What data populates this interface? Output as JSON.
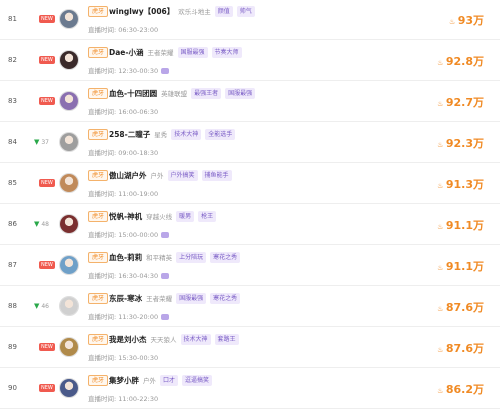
{
  "rows": [
    {
      "rank": "81",
      "new": "NEW",
      "change": "",
      "name": "winglwy【006】",
      "category": "欢乐斗地主",
      "tags": [
        "颜值",
        "帅气"
      ],
      "time_label": "直播时间:",
      "time": "06:30-23:00",
      "chat": false,
      "score": "93万",
      "avatar": "#6b7a8f"
    },
    {
      "rank": "82",
      "new": "NEW",
      "change": "",
      "name": "Dae-小涵",
      "category": "王者荣耀",
      "tags": [
        "国服最强",
        "节奏大师"
      ],
      "time_label": "直播时间:",
      "time": "12:30-00:30",
      "chat": true,
      "score": "92.8万",
      "avatar": "#3a2a2a"
    },
    {
      "rank": "83",
      "new": "NEW",
      "change": "",
      "name": "血色-十四团圆",
      "category": "英雄联盟",
      "tags": [
        "最强王者",
        "国服最强"
      ],
      "time_label": "直播时间:",
      "time": "16:00-06:30",
      "chat": false,
      "score": "92.7万",
      "avatar": "#8a6fb0"
    },
    {
      "rank": "84",
      "new": "",
      "change": "37",
      "name": "258-二瞳子",
      "category": "星秀",
      "tags": [
        "技术大神",
        "全能选手"
      ],
      "time_label": "直播时间:",
      "time": "09:00-18:30",
      "chat": false,
      "score": "92.3万",
      "avatar": "#9e9e9e"
    },
    {
      "rank": "85",
      "new": "NEW",
      "change": "",
      "name": "傲山湖户外",
      "category": "户外",
      "tags": [
        "户外搞笑",
        "捕鱼能手"
      ],
      "time_label": "直播时间:",
      "time": "11:00-19:00",
      "chat": false,
      "score": "91.3万",
      "avatar": "#c08a5a"
    },
    {
      "rank": "86",
      "new": "",
      "change": "48",
      "name": "悦帆-神机",
      "category": "穿越火线",
      "tags": [
        "暖男",
        "枪王"
      ],
      "time_label": "直播时间:",
      "time": "15:00-00:00",
      "chat": true,
      "score": "91.1万",
      "avatar": "#7a2f2f"
    },
    {
      "rank": "87",
      "new": "NEW",
      "change": "",
      "name": "血色-莉莉",
      "category": "和平精英",
      "tags": [
        "上分陪玩",
        "寒花之秀"
      ],
      "time_label": "直播时间:",
      "time": "16:30-04:30",
      "chat": true,
      "score": "91.1万",
      "avatar": "#6fa0c8"
    },
    {
      "rank": "88",
      "new": "",
      "change": "46",
      "name": "东辰-寒冰",
      "category": "王者荣耀",
      "tags": [
        "国服最强",
        "寒花之秀"
      ],
      "time_label": "直播时间:",
      "time": "11:30-20:00",
      "chat": true,
      "score": "87.6万",
      "avatar": "#d0d0d0"
    },
    {
      "rank": "89",
      "new": "NEW",
      "change": "",
      "name": "我是刘小杰",
      "category": "天天狼人",
      "tags": [
        "技术大神",
        "套路王"
      ],
      "time_label": "直播时间:",
      "time": "15:30-00:30",
      "chat": false,
      "score": "87.6万",
      "avatar": "#b08a4a"
    },
    {
      "rank": "90",
      "new": "NEW",
      "change": "",
      "name": "集梦小胖",
      "category": "户外",
      "tags": [
        "口才",
        "逗逼搞笑"
      ],
      "time_label": "直播时间:",
      "time": "11:00-22:30",
      "chat": false,
      "score": "86.2万",
      "avatar": "#4a5a8a"
    }
  ],
  "badge_label": "虎牙",
  "fire_icon": "flame-icon"
}
